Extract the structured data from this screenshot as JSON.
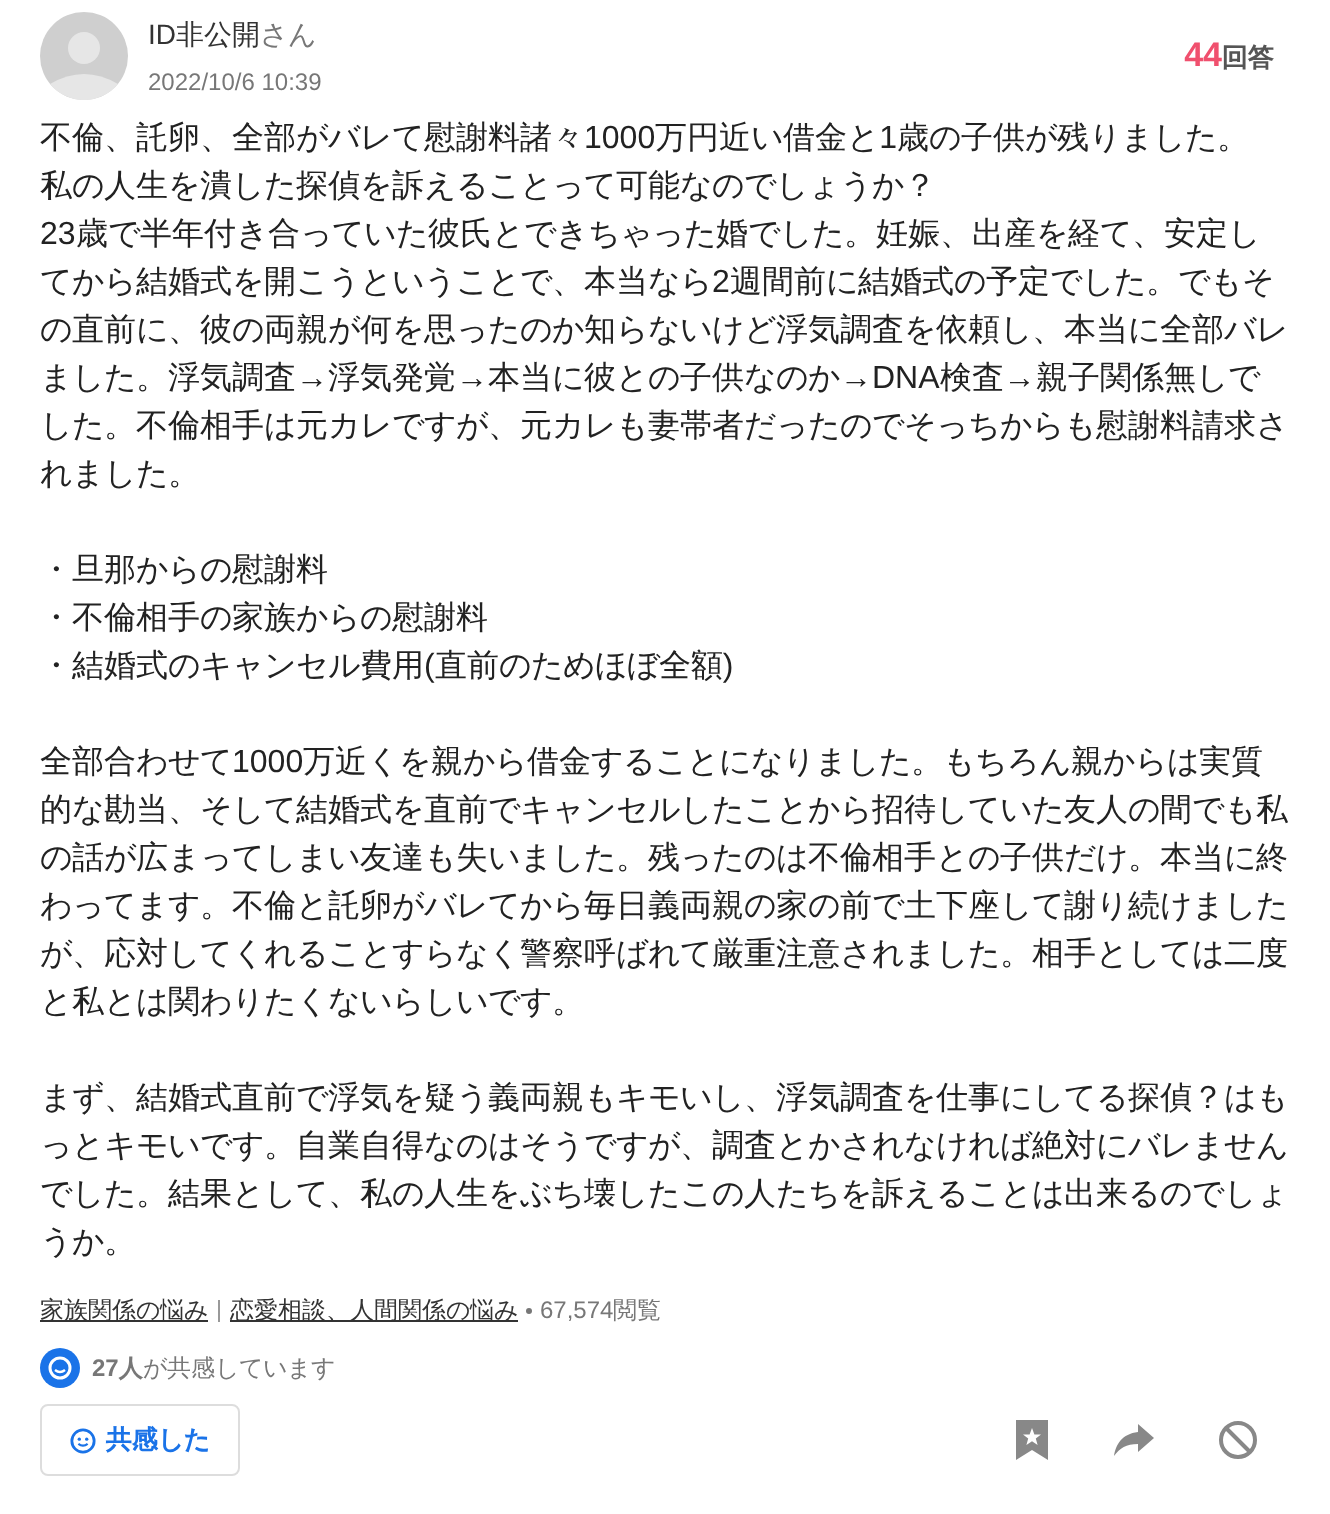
{
  "author": {
    "name": "ID非公開",
    "suffix": "さん",
    "date": "2022/10/6 10:39"
  },
  "answers": {
    "count": "44",
    "label": "回答"
  },
  "paragraphs": [
    [
      "不倫、託卵、全部がバレて慰謝料諸々1000万円近い借金と1歳の子供が残りました。",
      "私の人生を潰した探偵を訴えることって可能なのでしょうか？",
      "23歳で半年付き合っていた彼氏とできちゃった婚でした。妊娠、出産を経て、安定してから結婚式を開こうということで、本当なら2週間前に結婚式の予定でした。でもその直前に、彼の両親が何を思ったのか知らないけど浮気調査を依頼し、本当に全部バレました。浮気調査→浮気発覚→本当に彼との子供なのか→DNA検査→親子関係無しでした。不倫相手は元カレですが、元カレも妻帯者だったのでそっちからも慰謝料請求されました。"
    ],
    [
      "・旦那からの慰謝料",
      "・不倫相手の家族からの慰謝料",
      "・結婚式のキャンセル費用(直前のためほぼ全額)"
    ],
    [
      "全部合わせて1000万近くを親から借金することになりました。もちろん親からは実質的な勘当、そして結婚式を直前でキャンセルしたことから招待していた友人の間でも私の話が広まってしまい友達も失いました。残ったのは不倫相手との子供だけ。本当に終わってます。不倫と託卵がバレてから毎日義両親の家の前で土下座して謝り続けましたが、応対してくれることすらなく警察呼ばれて厳重注意されました。相手としては二度と私とは関わりたくないらしいです。"
    ],
    [
      "まず、結婚式直前で浮気を疑う義両親もキモいし、浮気調査を仕事にしてる探偵？はもっとキモいです。自業自得なのはそうですが、調査とかされなければ絶対にバレませんでした。結果として、私の人生をぶち壊したこの人たちを訴えることは出来るのでしょうか。"
    ]
  ],
  "categories": [
    "家族関係の悩み",
    "恋愛相談、人間関係の悩み"
  ],
  "views": "67,574閲覧",
  "empathy": "**27人**が共感しています",
  "empathy_button": {
    "label": "共感した",
    "selected": false
  }
}
